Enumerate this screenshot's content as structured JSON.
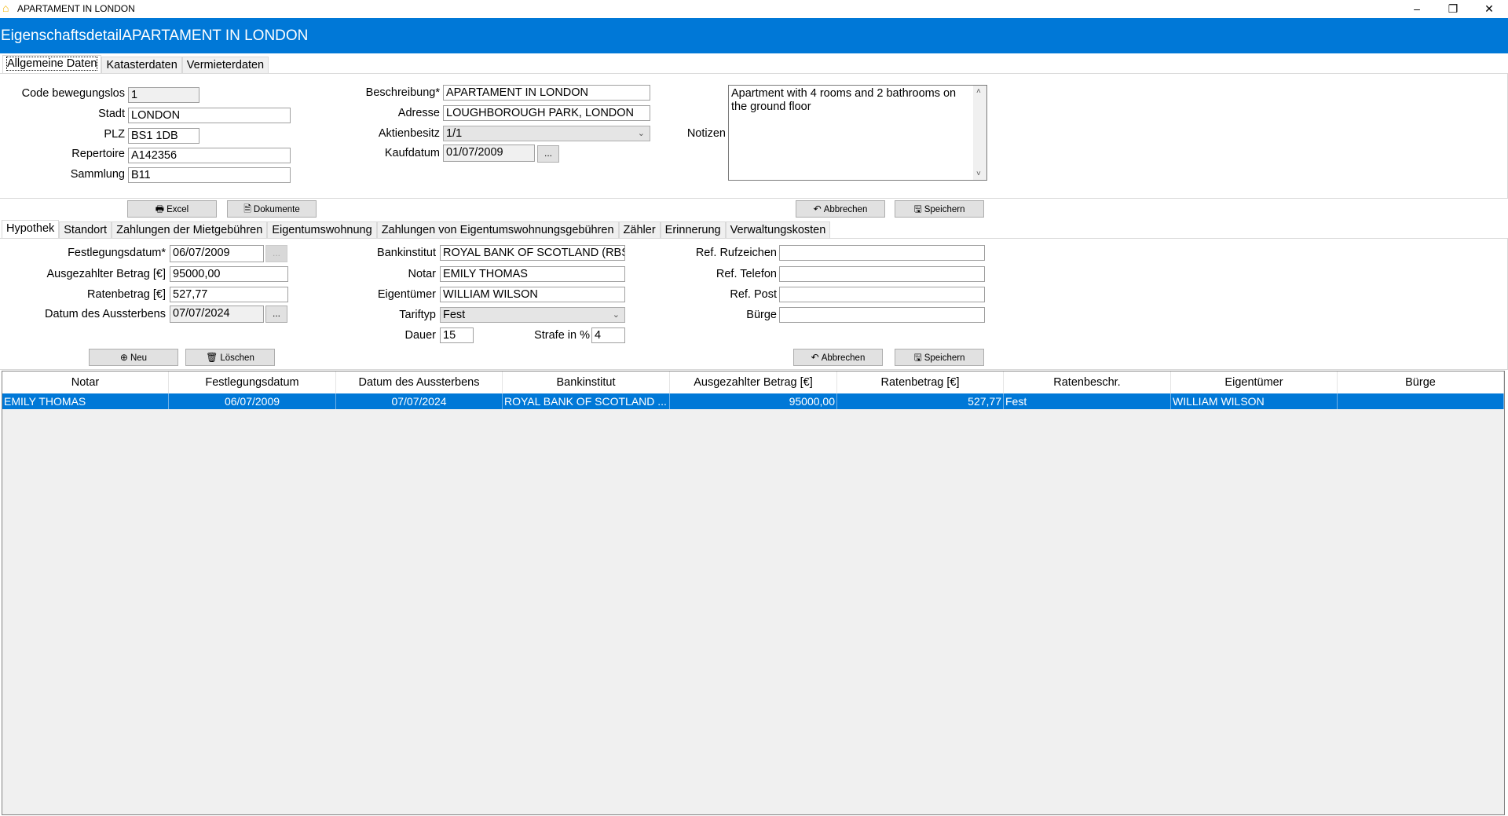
{
  "window": {
    "title": "APARTAMENT IN LONDON",
    "minimize": "–",
    "restore": "❐",
    "close": "✕",
    "app_icon": "house-icon"
  },
  "header": {
    "title": "EigenschaftsdetailAPARTAMENT IN LONDON"
  },
  "top_tabs": [
    "Allgemeine Daten",
    "Katasterdaten",
    "Vermieterdaten"
  ],
  "general": {
    "code_label": "Code bewegungslos",
    "code_value": "1",
    "stadt_label": "Stadt",
    "stadt_value": "LONDON",
    "plz_label": "PLZ",
    "plz_value": "BS1 1DB",
    "repertoire_label": "Repertoire",
    "repertoire_value": "A142356",
    "sammlung_label": "Sammlung",
    "sammlung_value": "B11",
    "beschreibung_label": "Beschreibung*",
    "beschreibung_value": "APARTAMENT IN LONDON",
    "adresse_label": "Adresse",
    "adresse_value": "LOUGHBOROUGH PARK, LONDON",
    "aktienbesitz_label": "Aktienbesitz",
    "aktienbesitz_value": "1/1",
    "kaufdatum_label": "Kaufdatum",
    "kaufdatum_value": "01/07/2009",
    "notizen_label": "Notizen",
    "notizen_value": "Apartment with 4 rooms and 2 bathrooms on the ground floor",
    "excel": "Excel",
    "dokumente": "Dokumente",
    "abbrechen": "Abbrechen",
    "speichern": "Speichern",
    "dots": "..."
  },
  "sub_tabs": [
    "Hypothek",
    "Standort",
    "Zahlungen der Mietgebühren",
    "Eigentumswohnung",
    "Zahlungen von Eigentumswohnungsgebühren",
    "Zähler",
    "Erinnerung",
    "Verwaltungskosten"
  ],
  "mortgage": {
    "festlegung_label": "Festlegungsdatum*",
    "festlegung_value": "06/07/2009",
    "betrag_label": "Ausgezahlter Betrag [€]",
    "betrag_value": "95000,00",
    "raten_label": "Ratenbetrag [€]",
    "raten_value": "527,77",
    "aussterben_label": "Datum des Aussterbens",
    "aussterben_value": "07/07/2024",
    "bank_label": "Bankinstitut",
    "bank_value": "ROYAL BANK OF SCOTLAND (RBS)",
    "notar_label": "Notar",
    "notar_value": "EMILY THOMAS",
    "eigentuemer_label": "Eigentümer",
    "eigentuemer_value": "WILLIAM WILSON",
    "tarif_label": "Tariftyp",
    "tarif_value": "Fest",
    "dauer_label": "Dauer",
    "dauer_value": "15",
    "strafe_label": "Strafe in %",
    "strafe_value": "4",
    "rufzeichen_label": "Ref. Rufzeichen",
    "rufzeichen_value": "",
    "telefon_label": "Ref. Telefon",
    "telefon_value": "",
    "post_label": "Ref. Post",
    "post_value": "",
    "buerge_label": "Bürge",
    "buerge_value": "",
    "neu": "Neu",
    "loeschen": "Löschen",
    "abbrechen": "Abbrechen",
    "speichern": "Speichern",
    "dots": "..."
  },
  "table": {
    "columns": [
      "Notar",
      "Festlegungsdatum",
      "Datum des Aussterbens",
      "Bankinstitut",
      "Ausgezahlter Betrag [€]",
      "Ratenbetrag [€]",
      "Ratenbeschr.",
      "Eigentümer",
      "Bürge"
    ],
    "rows": [
      [
        "EMILY THOMAS",
        "06/07/2009",
        "07/07/2024",
        "ROYAL BANK OF SCOTLAND ...",
        "95000,00",
        "527,77",
        "Fest",
        "WILLIAM WILSON",
        ""
      ]
    ]
  },
  "colors": {
    "accent": "#0078d7",
    "selection": "#0078d7"
  }
}
